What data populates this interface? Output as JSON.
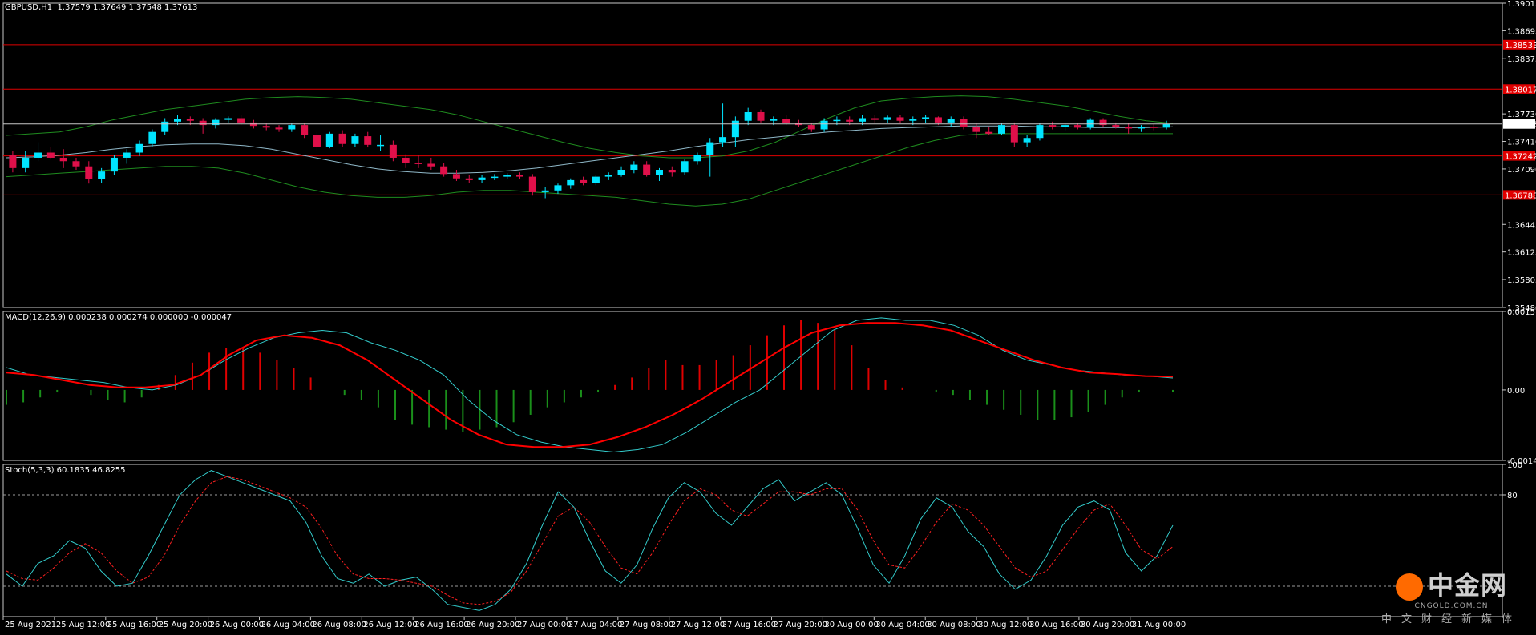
{
  "header": {
    "symbol": "GBPUSD,H1",
    "ohlc": "1.37579 1.37649 1.37548 1.37613"
  },
  "macd_label": "MACD(12,26,9) 0.000238 0.000274 0.000000 -0.000047",
  "stoch_label": "Stoch(5,3,3) 60.1835 46.8255",
  "colors": {
    "background": "#000000",
    "bull": "#00e5ff",
    "bear": "#e0104a",
    "bands": "#1f8b1f",
    "hline": "#e00000",
    "price_line": "#c8c8c8",
    "macd_hist_pos": "#e00000",
    "macd_hist_neg": "#1a8f1a",
    "macd_signal": "#ff0000",
    "stoch_main": "#33cccc",
    "stoch_signal": "#ff2020"
  },
  "chart_data": [
    {
      "type": "candlestick",
      "title": "GBPUSD,H1",
      "ylim": [
        1.3548,
        1.39015
      ],
      "y_ticks": [
        "1.39015",
        "1.38695",
        "1.38375",
        "1.37730",
        "1.37410",
        "1.37090",
        "1.36445",
        "1.36125",
        "1.35805",
        "1.35480"
      ],
      "current_price": "1.37613",
      "horizontal_levels": [
        {
          "value": 1.38533,
          "label": "1.38533"
        },
        {
          "value": 1.38017,
          "label": "1.38017"
        },
        {
          "value": 1.37242,
          "label": "1.37242"
        },
        {
          "value": 1.36788,
          "label": "1.36788"
        }
      ],
      "candles": [
        {
          "o": 1.3725,
          "h": 1.373,
          "l": 1.3705,
          "c": 1.371
        },
        {
          "o": 1.371,
          "h": 1.373,
          "l": 1.3705,
          "c": 1.3722
        },
        {
          "o": 1.3722,
          "h": 1.374,
          "l": 1.3718,
          "c": 1.3728
        },
        {
          "o": 1.3728,
          "h": 1.3735,
          "l": 1.372,
          "c": 1.3722
        },
        {
          "o": 1.3722,
          "h": 1.3732,
          "l": 1.371,
          "c": 1.3718
        },
        {
          "o": 1.3718,
          "h": 1.3722,
          "l": 1.3708,
          "c": 1.3712
        },
        {
          "o": 1.3712,
          "h": 1.3718,
          "l": 1.3692,
          "c": 1.3697
        },
        {
          "o": 1.3697,
          "h": 1.371,
          "l": 1.3693,
          "c": 1.3706
        },
        {
          "o": 1.3706,
          "h": 1.3725,
          "l": 1.3702,
          "c": 1.3722
        },
        {
          "o": 1.3722,
          "h": 1.3732,
          "l": 1.3715,
          "c": 1.3728
        },
        {
          "o": 1.3728,
          "h": 1.3742,
          "l": 1.3724,
          "c": 1.3738
        },
        {
          "o": 1.3738,
          "h": 1.3755,
          "l": 1.3735,
          "c": 1.3752
        },
        {
          "o": 1.3752,
          "h": 1.3768,
          "l": 1.3748,
          "c": 1.3764
        },
        {
          "o": 1.3764,
          "h": 1.3772,
          "l": 1.376,
          "c": 1.3767
        },
        {
          "o": 1.3767,
          "h": 1.377,
          "l": 1.376,
          "c": 1.3765
        },
        {
          "o": 1.3765,
          "h": 1.3768,
          "l": 1.375,
          "c": 1.376
        },
        {
          "o": 1.376,
          "h": 1.3768,
          "l": 1.3756,
          "c": 1.3766
        },
        {
          "o": 1.3766,
          "h": 1.377,
          "l": 1.3762,
          "c": 1.3768
        },
        {
          "o": 1.3768,
          "h": 1.3772,
          "l": 1.376,
          "c": 1.3763
        },
        {
          "o": 1.3763,
          "h": 1.3766,
          "l": 1.3756,
          "c": 1.3759
        },
        {
          "o": 1.3759,
          "h": 1.3762,
          "l": 1.3754,
          "c": 1.3757
        },
        {
          "o": 1.3757,
          "h": 1.376,
          "l": 1.3752,
          "c": 1.3755
        },
        {
          "o": 1.3755,
          "h": 1.3762,
          "l": 1.3752,
          "c": 1.376
        },
        {
          "o": 1.376,
          "h": 1.3762,
          "l": 1.3745,
          "c": 1.3748
        },
        {
          "o": 1.3748,
          "h": 1.3752,
          "l": 1.373,
          "c": 1.3735
        },
        {
          "o": 1.3735,
          "h": 1.3752,
          "l": 1.3733,
          "c": 1.375
        },
        {
          "o": 1.375,
          "h": 1.3754,
          "l": 1.3735,
          "c": 1.3738
        },
        {
          "o": 1.3738,
          "h": 1.375,
          "l": 1.3735,
          "c": 1.3747
        },
        {
          "o": 1.3747,
          "h": 1.3752,
          "l": 1.3734,
          "c": 1.3737
        },
        {
          "o": 1.3737,
          "h": 1.3748,
          "l": 1.373,
          "c": 1.3737
        },
        {
          "o": 1.3737,
          "h": 1.3742,
          "l": 1.3718,
          "c": 1.3722
        },
        {
          "o": 1.3722,
          "h": 1.3726,
          "l": 1.371,
          "c": 1.3716
        },
        {
          "o": 1.3716,
          "h": 1.3725,
          "l": 1.371,
          "c": 1.3715
        },
        {
          "o": 1.3715,
          "h": 1.3722,
          "l": 1.3708,
          "c": 1.3712
        },
        {
          "o": 1.3712,
          "h": 1.3716,
          "l": 1.37,
          "c": 1.3703
        },
        {
          "o": 1.3703,
          "h": 1.3708,
          "l": 1.3695,
          "c": 1.3698
        },
        {
          "o": 1.3698,
          "h": 1.3702,
          "l": 1.3693,
          "c": 1.3696
        },
        {
          "o": 1.3696,
          "h": 1.3702,
          "l": 1.3693,
          "c": 1.3699
        },
        {
          "o": 1.3699,
          "h": 1.3703,
          "l": 1.3696,
          "c": 1.37
        },
        {
          "o": 1.37,
          "h": 1.3704,
          "l": 1.3697,
          "c": 1.3702
        },
        {
          "o": 1.3702,
          "h": 1.3705,
          "l": 1.3697,
          "c": 1.37
        },
        {
          "o": 1.37,
          "h": 1.3703,
          "l": 1.3678,
          "c": 1.3682
        },
        {
          "o": 1.3682,
          "h": 1.3688,
          "l": 1.3675,
          "c": 1.3684
        },
        {
          "o": 1.3684,
          "h": 1.3692,
          "l": 1.368,
          "c": 1.369
        },
        {
          "o": 1.369,
          "h": 1.3698,
          "l": 1.3686,
          "c": 1.3696
        },
        {
          "o": 1.3696,
          "h": 1.37,
          "l": 1.369,
          "c": 1.3693
        },
        {
          "o": 1.3693,
          "h": 1.3702,
          "l": 1.369,
          "c": 1.37
        },
        {
          "o": 1.37,
          "h": 1.3705,
          "l": 1.3696,
          "c": 1.3702
        },
        {
          "o": 1.3702,
          "h": 1.3712,
          "l": 1.37,
          "c": 1.3708
        },
        {
          "o": 1.3708,
          "h": 1.3718,
          "l": 1.3704,
          "c": 1.3714
        },
        {
          "o": 1.3714,
          "h": 1.3718,
          "l": 1.37,
          "c": 1.3702
        },
        {
          "o": 1.3702,
          "h": 1.371,
          "l": 1.3695,
          "c": 1.3708
        },
        {
          "o": 1.3708,
          "h": 1.3712,
          "l": 1.37,
          "c": 1.3705
        },
        {
          "o": 1.3705,
          "h": 1.372,
          "l": 1.3702,
          "c": 1.3718
        },
        {
          "o": 1.3718,
          "h": 1.3728,
          "l": 1.3714,
          "c": 1.3725
        },
        {
          "o": 1.3725,
          "h": 1.3745,
          "l": 1.37,
          "c": 1.374
        },
        {
          "o": 1.374,
          "h": 1.3785,
          "l": 1.3735,
          "c": 1.3746
        },
        {
          "o": 1.3746,
          "h": 1.377,
          "l": 1.3735,
          "c": 1.3765
        },
        {
          "o": 1.3765,
          "h": 1.378,
          "l": 1.376,
          "c": 1.3775
        },
        {
          "o": 1.3775,
          "h": 1.3778,
          "l": 1.3763,
          "c": 1.3765
        },
        {
          "o": 1.3765,
          "h": 1.377,
          "l": 1.376,
          "c": 1.3767
        },
        {
          "o": 1.3767,
          "h": 1.3772,
          "l": 1.376,
          "c": 1.3762
        },
        {
          "o": 1.3762,
          "h": 1.3766,
          "l": 1.3758,
          "c": 1.376
        },
        {
          "o": 1.376,
          "h": 1.3762,
          "l": 1.3752,
          "c": 1.3755
        },
        {
          "o": 1.3755,
          "h": 1.3768,
          "l": 1.3752,
          "c": 1.3765
        },
        {
          "o": 1.3765,
          "h": 1.377,
          "l": 1.376,
          "c": 1.3766
        },
        {
          "o": 1.3766,
          "h": 1.377,
          "l": 1.376,
          "c": 1.3764
        },
        {
          "o": 1.3764,
          "h": 1.3772,
          "l": 1.376,
          "c": 1.3768
        },
        {
          "o": 1.3768,
          "h": 1.3772,
          "l": 1.3762,
          "c": 1.3766
        },
        {
          "o": 1.3766,
          "h": 1.3771,
          "l": 1.3762,
          "c": 1.3769
        },
        {
          "o": 1.3769,
          "h": 1.3772,
          "l": 1.3762,
          "c": 1.3765
        },
        {
          "o": 1.3765,
          "h": 1.377,
          "l": 1.376,
          "c": 1.3767
        },
        {
          "o": 1.3767,
          "h": 1.3772,
          "l": 1.3762,
          "c": 1.3769
        },
        {
          "o": 1.3769,
          "h": 1.377,
          "l": 1.376,
          "c": 1.3763
        },
        {
          "o": 1.3763,
          "h": 1.377,
          "l": 1.3758,
          "c": 1.3767
        },
        {
          "o": 1.3767,
          "h": 1.377,
          "l": 1.3755,
          "c": 1.3758
        },
        {
          "o": 1.3758,
          "h": 1.3762,
          "l": 1.3745,
          "c": 1.3752
        },
        {
          "o": 1.3752,
          "h": 1.3758,
          "l": 1.3748,
          "c": 1.375
        },
        {
          "o": 1.375,
          "h": 1.3762,
          "l": 1.3748,
          "c": 1.376
        },
        {
          "o": 1.376,
          "h": 1.3763,
          "l": 1.3735,
          "c": 1.374
        },
        {
          "o": 1.374,
          "h": 1.3748,
          "l": 1.3735,
          "c": 1.3745
        },
        {
          "o": 1.3745,
          "h": 1.3762,
          "l": 1.3742,
          "c": 1.376
        },
        {
          "o": 1.376,
          "h": 1.3764,
          "l": 1.3755,
          "c": 1.3758
        },
        {
          "o": 1.3758,
          "h": 1.3762,
          "l": 1.3754,
          "c": 1.376
        },
        {
          "o": 1.376,
          "h": 1.3762,
          "l": 1.3755,
          "c": 1.3757
        },
        {
          "o": 1.3757,
          "h": 1.3768,
          "l": 1.3755,
          "c": 1.3766
        },
        {
          "o": 1.3766,
          "h": 1.3768,
          "l": 1.3758,
          "c": 1.376
        },
        {
          "o": 1.376,
          "h": 1.3763,
          "l": 1.3756,
          "c": 1.3758
        },
        {
          "o": 1.3758,
          "h": 1.3762,
          "l": 1.375,
          "c": 1.3756
        },
        {
          "o": 1.3756,
          "h": 1.376,
          "l": 1.3752,
          "c": 1.3758
        },
        {
          "o": 1.3758,
          "h": 1.3761,
          "l": 1.3754,
          "c": 1.3757
        },
        {
          "o": 1.3757,
          "h": 1.3765,
          "l": 1.3755,
          "c": 1.3761
        }
      ],
      "bb_upper": [
        1.3748,
        1.375,
        1.3752,
        1.3758,
        1.3766,
        1.3772,
        1.3778,
        1.3782,
        1.3786,
        1.379,
        1.3792,
        1.3793,
        1.3792,
        1.379,
        1.3786,
        1.3782,
        1.3778,
        1.3772,
        1.3764,
        1.3756,
        1.3748,
        1.374,
        1.3733,
        1.3728,
        1.3724,
        1.3722,
        1.3722,
        1.3724,
        1.373,
        1.374,
        1.3754,
        1.3768,
        1.378,
        1.3788,
        1.3791,
        1.3793,
        1.3794,
        1.3793,
        1.379,
        1.3786,
        1.3782,
        1.3776,
        1.377,
        1.3765,
        1.3762
      ],
      "bb_mid": [
        1.3722,
        1.3723,
        1.3725,
        1.3728,
        1.3732,
        1.3735,
        1.3737,
        1.3738,
        1.3738,
        1.3736,
        1.3732,
        1.3726,
        1.372,
        1.3714,
        1.3709,
        1.3706,
        1.3704,
        1.3704,
        1.3705,
        1.3707,
        1.371,
        1.3714,
        1.3718,
        1.3722,
        1.3726,
        1.373,
        1.3735,
        1.3739,
        1.3743,
        1.3746,
        1.3749,
        1.3752,
        1.3754,
        1.3756,
        1.3757,
        1.3758,
        1.3759,
        1.3759,
        1.3759,
        1.3758,
        1.3758,
        1.3757,
        1.3757,
        1.3757,
        1.3758
      ],
      "bb_lower": [
        1.37,
        1.3702,
        1.3704,
        1.3706,
        1.3708,
        1.371,
        1.3712,
        1.3712,
        1.371,
        1.3704,
        1.3696,
        1.3688,
        1.3682,
        1.3678,
        1.3676,
        1.3676,
        1.3678,
        1.3682,
        1.3684,
        1.3684,
        1.3682,
        1.368,
        1.3678,
        1.3676,
        1.3672,
        1.3668,
        1.3666,
        1.3668,
        1.3674,
        1.3684,
        1.3694,
        1.3704,
        1.3714,
        1.3724,
        1.3734,
        1.3742,
        1.3748,
        1.375,
        1.375,
        1.375,
        1.375,
        1.375,
        1.375,
        1.375,
        1.375
      ]
    },
    {
      "type": "macd",
      "title": "MACD(12,26,9) 0.000238 0.000274 0.000000 -0.000047",
      "ylim": [
        -0.001419,
        0.001578
      ],
      "y_ticks": [
        "0.001578",
        "0.00",
        "-0.001419"
      ],
      "histogram": [
        -0.0003,
        -0.00025,
        -0.00015,
        -5e-05,
        0.0,
        -0.0001,
        -0.0002,
        -0.00025,
        -0.00015,
        0.0001,
        0.0003,
        0.00055,
        0.00075,
        0.00085,
        0.00085,
        0.00075,
        0.0006,
        0.00045,
        0.00025,
        0.0,
        -0.0001,
        -0.0002,
        -0.00035,
        -0.0006,
        -0.0007,
        -0.00075,
        -0.0008,
        -0.00085,
        -0.0008,
        -0.00075,
        -0.00065,
        -0.0005,
        -0.00035,
        -0.00025,
        -0.00015,
        -5e-05,
        0.0001,
        0.00025,
        0.00045,
        0.0006,
        0.0005,
        0.0005,
        0.0006,
        0.0007,
        0.0009,
        0.0011,
        0.0013,
        0.0014,
        0.00135,
        0.0012,
        0.0009,
        0.00045,
        0.0002,
        5e-05,
        0.0,
        -5e-05,
        -0.0001,
        -0.0002,
        -0.0003,
        -0.0004,
        -0.0005,
        -0.0006,
        -0.0006,
        -0.00055,
        -0.00045,
        -0.0003,
        -0.00015,
        -5e-05,
        0.0,
        -5e-05
      ],
      "macd_line": [
        0.00045,
        0.0003,
        0.00025,
        0.0002,
        0.00015,
        5e-05,
        0.0,
        0.0001,
        0.0003,
        0.0006,
        0.00085,
        0.00105,
        0.00115,
        0.0012,
        0.00115,
        0.00095,
        0.0008,
        0.0006,
        0.0003,
        -0.0002,
        -0.0006,
        -0.0009,
        -0.00105,
        -0.00115,
        -0.0012,
        -0.00125,
        -0.0012,
        -0.0011,
        -0.00085,
        -0.00055,
        -0.00025,
        0.0,
        0.0004,
        0.0008,
        0.0012,
        0.0014,
        0.00145,
        0.0014,
        0.0014,
        0.0013,
        0.0011,
        0.0008,
        0.0006,
        0.0005,
        0.0004,
        0.00035,
        0.0003,
        0.00028,
        0.00024
      ],
      "signal_line": [
        0.00035,
        0.0003,
        0.0002,
        0.0001,
        5e-05,
        5e-05,
        0.0001,
        0.0003,
        0.0007,
        0.001,
        0.0011,
        0.00105,
        0.0009,
        0.0006,
        0.0002,
        -0.0002,
        -0.0006,
        -0.0009,
        -0.0011,
        -0.00115,
        -0.00115,
        -0.0011,
        -0.00095,
        -0.00075,
        -0.0005,
        -0.0002,
        0.00015,
        0.0005,
        0.00085,
        0.00115,
        0.0013,
        0.00135,
        0.00135,
        0.0013,
        0.0012,
        0.001,
        0.0008,
        0.0006,
        0.00045,
        0.00035,
        0.00032,
        0.00028,
        0.00027
      ]
    },
    {
      "type": "line",
      "title": "Stoch(5,3,3) 60.1835 46.8255",
      "ylim": [
        0,
        100
      ],
      "y_ticks": [
        "100",
        "80"
      ],
      "levels": [
        80,
        20
      ],
      "k": [
        28,
        20,
        35,
        40,
        50,
        45,
        30,
        20,
        22,
        40,
        60,
        80,
        90,
        96,
        92,
        88,
        84,
        80,
        76,
        62,
        40,
        25,
        22,
        28,
        20,
        24,
        26,
        18,
        8,
        6,
        4,
        8,
        18,
        35,
        60,
        82,
        72,
        50,
        30,
        22,
        34,
        58,
        78,
        88,
        82,
        68,
        60,
        72,
        84,
        90,
        76,
        82,
        88,
        80,
        58,
        34,
        22,
        40,
        64,
        78,
        72,
        56,
        46,
        28,
        18,
        24,
        40,
        60,
        72,
        76,
        70,
        42,
        30,
        40,
        60
      ],
      "d": [
        30,
        25,
        24,
        32,
        42,
        48,
        42,
        30,
        22,
        26,
        40,
        60,
        76,
        88,
        92,
        90,
        86,
        82,
        78,
        72,
        58,
        40,
        28,
        25,
        25,
        24,
        22,
        20,
        14,
        9,
        8,
        10,
        16,
        30,
        48,
        66,
        72,
        62,
        46,
        32,
        28,
        42,
        60,
        76,
        84,
        80,
        70,
        66,
        74,
        82,
        82,
        80,
        84,
        84,
        70,
        50,
        34,
        32,
        46,
        62,
        74,
        70,
        60,
        46,
        32,
        26,
        30,
        44,
        58,
        70,
        74,
        60,
        44,
        38,
        46
      ]
    },
    {
      "type": "axis",
      "x_labels": [
        "25 Aug 2021",
        "25 Aug 12:00",
        "25 Aug 16:00",
        "25 Aug 20:00",
        "26 Aug 00:00",
        "26 Aug 04:00",
        "26 Aug 08:00",
        "26 Aug 12:00",
        "26 Aug 16:00",
        "26 Aug 20:00",
        "27 Aug 00:00",
        "27 Aug 04:00",
        "27 Aug 08:00",
        "27 Aug 12:00",
        "27 Aug 16:00",
        "27 Aug 20:00",
        "30 Aug 00:00",
        "30 Aug 04:00",
        "30 Aug 08:00",
        "30 Aug 12:00",
        "30 Aug 16:00",
        "30 Aug 20:00",
        "31 Aug 00:00"
      ]
    }
  ],
  "watermark": {
    "title": "中金网",
    "url": "CNGOLD.COM.CN",
    "subtitle": "中文财经新媒体"
  }
}
